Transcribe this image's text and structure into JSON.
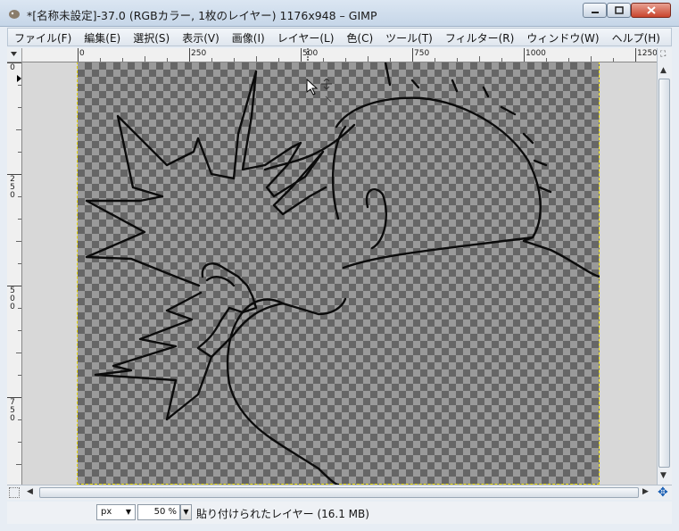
{
  "window": {
    "title": "*[名称未設定]-37.0 (RGBカラー, 1枚のレイヤー) 1176x948 – GIMP",
    "buttons": {
      "minimize": "—",
      "maximize": "▢",
      "close": "✕"
    }
  },
  "menubar": {
    "items": [
      "ファイル(F)",
      "編集(E)",
      "選択(S)",
      "表示(V)",
      "画像(I)",
      "レイヤー(L)",
      "色(C)",
      "ツール(T)",
      "フィルター(R)",
      "ウィンドウ(W)",
      "ヘルプ(H)"
    ]
  },
  "rulers": {
    "horizontal_labels": [
      "0",
      "250",
      "500",
      "750",
      "1000",
      "1250"
    ],
    "vertical_labels": [
      "0",
      "250",
      "500",
      "750"
    ]
  },
  "statusbar": {
    "unit": "px",
    "zoom": "50 %",
    "message": "貼り付けられたレイヤー (16.1 MB)"
  },
  "icons": {
    "app": "gimp-icon",
    "navigate": "navigate-icon",
    "quick_mask": "quick-mask-icon"
  }
}
